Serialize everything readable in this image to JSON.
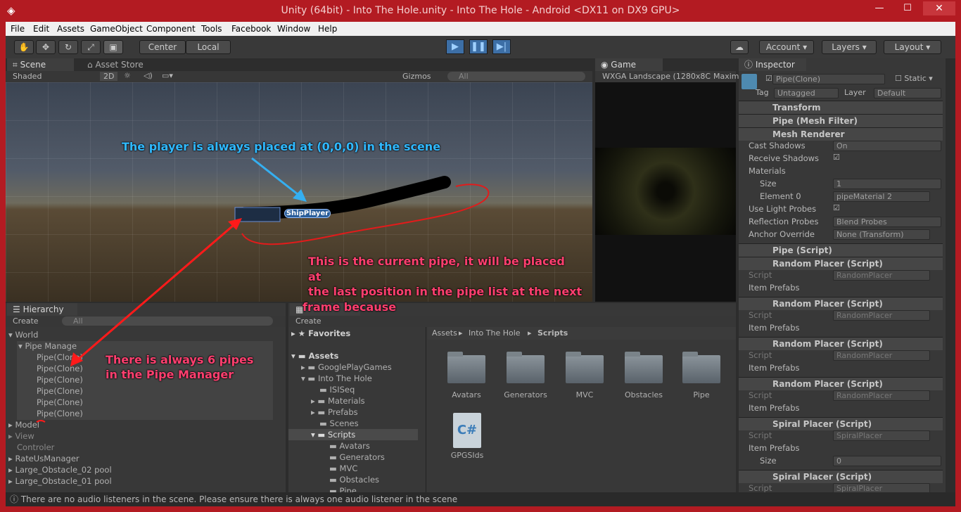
{
  "window": {
    "title": "Unity (64bit) - Into The Hole.unity - Into The Hole - Android <DX11 on DX9 GPU>",
    "close": "✕",
    "minimize": "—",
    "maximize": "☐"
  },
  "menu": [
    "File",
    "Edit",
    "Assets",
    "GameObject",
    "Component",
    "Tools",
    "Facebook",
    "Window",
    "Help"
  ],
  "toolbar": {
    "pivot": "Center",
    "space": "Local",
    "account": "Account",
    "layers": "Layers",
    "layout": "Layout"
  },
  "scene": {
    "tab": "Scene",
    "tab2": "Asset Store",
    "shaded": "Shaded",
    "mode2d": "2D",
    "gizmos": "Gizmos",
    "search_placeholder": "All",
    "object_label": "ShipPlayer"
  },
  "game": {
    "tab": "Game",
    "resolution": "WXGA Landscape (1280x8C",
    "maximize": "Maxim"
  },
  "annotations": {
    "player": "The player is always placed at (0,0,0) in the scene",
    "pipe_line1": "This is the current pipe, it will be placed",
    "pipe_line2": "at",
    "pipe_line3": "the last position in the pipe list at the next",
    "pipe_line4": "frame because",
    "manager_line1": "There is always 6 pipes",
    "manager_line2": "in the Pipe Manager"
  },
  "hierarchy": {
    "tab": "Hierarchy",
    "create": "Create",
    "search_placeholder": "All",
    "items": [
      "World",
      "Pipe Manage",
      "Pipe(Clone)",
      "Pipe(Clone)",
      "Pipe(Clone)",
      "Pipe(Clone)",
      "Pipe(Clone)",
      "Pipe(Clone)",
      "Model",
      "View",
      "Controler",
      "RateUsManager",
      "Large_Obstacle_02 pool",
      "Large_Obstacle_01 pool"
    ]
  },
  "project": {
    "create": "Create",
    "favorites": "Favorites",
    "tree": [
      "Assets",
      "GooglePlayGames",
      "Into The Hole",
      "ISISeq",
      "Materials",
      "Prefabs",
      "Scenes",
      "Scripts",
      "Avatars",
      "Generators",
      "MVC",
      "Obstacles",
      "Pipe"
    ],
    "breadcrumb": [
      "Assets",
      "Into The Hole",
      "Scripts"
    ],
    "folders": [
      "Avatars",
      "Generators",
      "MVC",
      "Obstacles",
      "Pipe"
    ],
    "file": "GPGSIds",
    "file_glyph": "C#"
  },
  "inspector": {
    "tab": "Inspector",
    "name": "Pipe(Clone)",
    "static": "Static",
    "tag_label": "Tag",
    "tag": "Untagged",
    "layer_label": "Layer",
    "layer": "Default",
    "components": [
      "Transform",
      "Pipe (Mesh Filter)",
      "Mesh Renderer",
      "Pipe (Script)",
      "Random Placer (Script)",
      "Random Placer (Script)",
      "Random Placer (Script)",
      "Random Placer (Script)",
      "Spiral Placer (Script)",
      "Spiral Placer (Script)"
    ],
    "mesh_renderer": {
      "cast_shadows_label": "Cast Shadows",
      "cast_shadows": "On",
      "receive_shadows_label": "Receive Shadows",
      "materials_label": "Materials",
      "size_label": "Size",
      "size": "1",
      "element0_label": "Element 0",
      "element0": "pipeMaterial 2",
      "light_probes_label": "Use Light Probes",
      "reflection_label": "Reflection Probes",
      "reflection": "Blend Probes",
      "anchor_label": "Anchor Override",
      "anchor": "None (Transform)"
    },
    "script_label": "Script",
    "item_prefabs_label": "Item Prefabs",
    "random_placer": "RandomPlacer",
    "spiral_placer": "SpiralPlacer",
    "spiral_size_label": "Size",
    "spiral_size": "0"
  },
  "status": "There are no audio listeners in the scene. Please ensure there is always one audio listener in the scene",
  "colors": {
    "title_bar": "#b31b22",
    "annotation_cyan": "#30b9ff",
    "annotation_pink": "#ff3f6f",
    "play_blue": "#3d6fa6"
  }
}
